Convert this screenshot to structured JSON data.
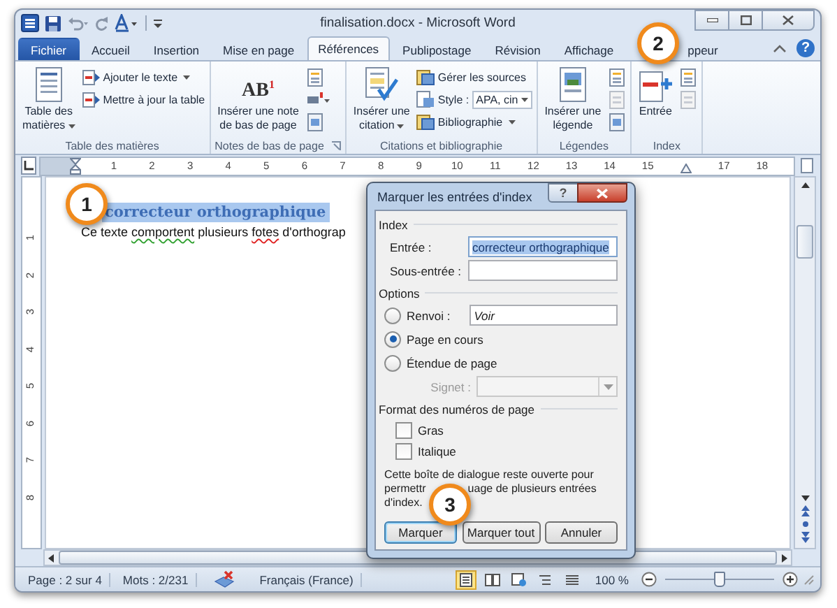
{
  "window": {
    "title": "finalisation.docx - Microsoft Word",
    "help": "?"
  },
  "tabs": [
    {
      "label": "Fichier",
      "kind": "file",
      "selected": false
    },
    {
      "label": "Accueil",
      "kind": "tab",
      "selected": false
    },
    {
      "label": "Insertion",
      "kind": "tab",
      "selected": false
    },
    {
      "label": "Mise en page",
      "kind": "tab",
      "selected": false
    },
    {
      "label": "Références",
      "kind": "tab",
      "selected": true
    },
    {
      "label": "Publipostage",
      "kind": "tab",
      "selected": false
    },
    {
      "label": "Révision",
      "kind": "tab",
      "selected": false
    },
    {
      "label": "Affichage",
      "kind": "tab",
      "selected": false
    },
    {
      "label": "ppeur",
      "kind": "tab",
      "selected": false
    }
  ],
  "ribbon": [
    {
      "kind": "toc",
      "label": "Table des matières",
      "launcher": false,
      "large": {
        "lines": [
          "Table des",
          "matières"
        ],
        "dropdown": true
      },
      "small": [
        {
          "kind": "button",
          "label": "Ajouter le texte",
          "dropdown": true
        },
        {
          "kind": "button",
          "label": "Mettre à jour la table",
          "dropdown": false
        }
      ]
    },
    {
      "kind": "footnotes",
      "label": "Notes de bas de page",
      "launcher": true,
      "large": {
        "lines": [
          "Insérer une note",
          "de bas de page"
        ],
        "dropdown": false,
        "icon_text": "AB$^{1}$"
      }
    },
    {
      "kind": "citations",
      "label": "Citations et bibliographie",
      "launcher": false,
      "large": {
        "lines": [
          "Insérer une",
          "citation"
        ],
        "dropdown": true
      },
      "small": [
        {
          "kind": "button",
          "label": "Gérer les sources",
          "dropdown": false
        },
        {
          "kind": "combo",
          "label": "Style :",
          "value": "APA, cin",
          "dropdown": true
        },
        {
          "kind": "button",
          "label": "Bibliographie",
          "dropdown": true
        }
      ]
    },
    {
      "kind": "captions",
      "label": "Légendes",
      "launcher": false,
      "large": {
        "lines": [
          "Insérer une",
          "légende"
        ],
        "dropdown": false
      }
    },
    {
      "kind": "index",
      "label": "Index",
      "launcher": false,
      "large": {
        "lines": [
          "Entrée"
        ],
        "dropdown": false
      }
    }
  ],
  "ruler": {
    "left_numbers": [
      "1",
      "2",
      "3",
      "4",
      "5",
      "6",
      "7",
      "8",
      "9",
      "10",
      "11",
      "12",
      "13",
      "14",
      "15"
    ],
    "right_numbers": [
      "17",
      "18"
    ]
  },
  "vertical_ruler": [
    "1",
    "2",
    "3",
    "4",
    "5",
    "6",
    "7",
    "8"
  ],
  "document": {
    "heading": {
      "text": "correcteur orthographique",
      "selected": true
    },
    "body": [
      {
        "text": "Ce texte ",
        "kind": "plain"
      },
      {
        "text": "comportent",
        "kind": "grammar"
      },
      {
        "text": " plusieurs ",
        "kind": "plain"
      },
      {
        "text": "fotes",
        "kind": "spelling"
      },
      {
        "text": " d'orthograp",
        "kind": "plain"
      }
    ]
  },
  "dialog": {
    "title": "Marquer les entrées d'index",
    "help": "?",
    "index_section": {
      "title": "Index",
      "fields": [
        {
          "label": "Entrée :",
          "value": "correcteur orthographique",
          "highlighted": true
        },
        {
          "label": "Sous-entrée :",
          "highlighted": false
        }
      ]
    },
    "options_section": {
      "title": "Options",
      "choices": [
        {
          "label": "Renvoi :",
          "selected": false,
          "field_value": "Voir"
        },
        {
          "label": "Page en cours",
          "selected": true
        },
        {
          "label": "Étendue de page",
          "selected": false
        }
      ],
      "bookmark": {
        "label": "Signet :",
        "disabled": true
      }
    },
    "format_section": {
      "title": "Format des numéros de page",
      "checks": [
        {
          "label": "Gras",
          "checked": false
        },
        {
          "label": "Italique",
          "checked": false
        }
      ]
    },
    "note": [
      {
        "parts": [
          "Cette boîte de dialogue reste ouverte pour"
        ]
      },
      {
        "parts": [
          "permettr",
          "uage de plusieurs entrées"
        ]
      },
      {
        "parts": [
          "d'index."
        ]
      }
    ],
    "buttons": [
      {
        "label": "Marquer",
        "default": true
      },
      {
        "label": "Marquer tout",
        "default": false
      },
      {
        "label": "Annuler",
        "default": false
      }
    ]
  },
  "status_bar": {
    "page": "Page : 2 sur 4",
    "words": "Mots : 2/231",
    "language": "Français (France)",
    "views": [
      {
        "kind": "print",
        "selected": true
      },
      {
        "kind": "reading",
        "selected": false
      },
      {
        "kind": "web",
        "selected": false
      },
      {
        "kind": "outline",
        "selected": false
      },
      {
        "kind": "draft",
        "selected": false
      }
    ],
    "zoom": "100 %",
    "zoom_slider": {
      "level": 0.5
    }
  },
  "callouts": [
    {
      "label": "1"
    },
    {
      "label": "2"
    },
    {
      "label": "3"
    }
  ]
}
